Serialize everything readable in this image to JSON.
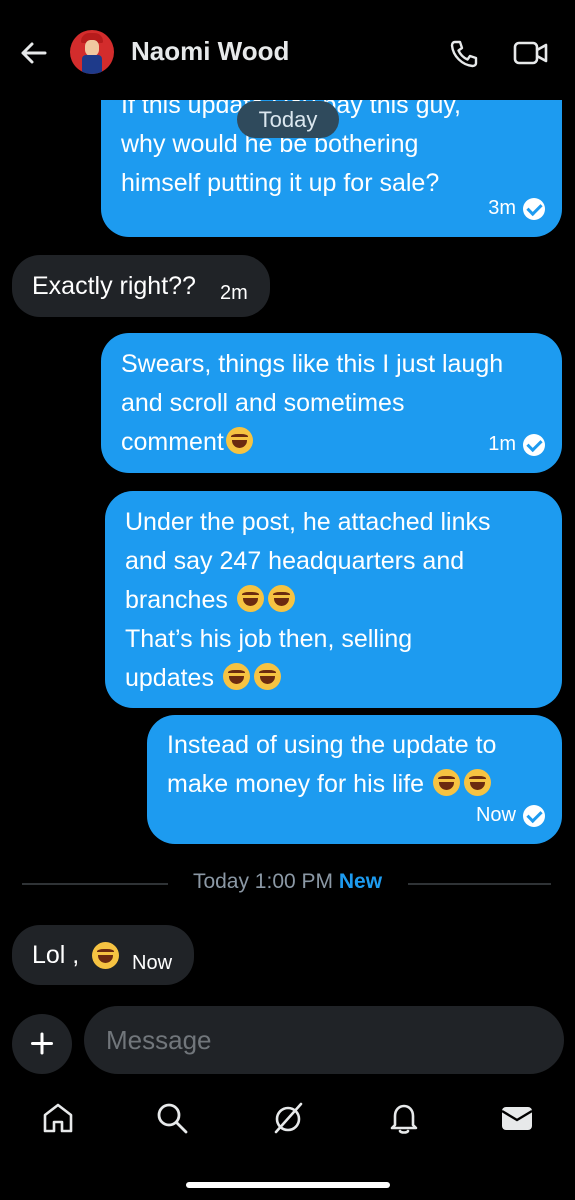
{
  "header": {
    "contact_name": "Naomi Wood",
    "back_icon": "arrow-left-icon",
    "call_icon": "phone-icon",
    "video_icon": "video-camera-icon"
  },
  "date_pill": "Today",
  "messages": [
    {
      "direction": "outgoing",
      "text": "If this update Dey pay this guy,\nwhy would he be bothering\nhimself putting it up for sale?",
      "time": "3m",
      "read": true
    },
    {
      "direction": "incoming",
      "text": "Exactly right??",
      "time": "2m"
    },
    {
      "direction": "outgoing",
      "text": "Swears, things like this I just laugh\nand scroll and sometimes\ncomment",
      "emoji_count": 1,
      "time": "1m",
      "read": true
    },
    {
      "direction": "outgoing",
      "lines": [
        "Under the post, he attached links",
        "and say 247 headquarters and",
        "branches",
        "That’s his job then, selling",
        "updates"
      ],
      "emoji": "face-with-tears-of-joy"
    },
    {
      "direction": "outgoing",
      "lines": [
        "Instead of using the update to",
        "make money for his life"
      ],
      "time": "Now",
      "read": true
    },
    {
      "direction": "incoming",
      "text": "Lol ,",
      "emoji": "grinning-squinting-face",
      "time": "Now"
    }
  ],
  "divider": {
    "label": "Today 1:00 PM",
    "new_label": "New"
  },
  "composer": {
    "placeholder": "Message",
    "plus_icon": "plus-icon"
  },
  "bottom_nav": [
    "home-icon",
    "search-icon",
    "grok-icon",
    "notifications-bell-icon",
    "messages-envelope-icon"
  ],
  "colors": {
    "background": "#000000",
    "outgoing_bubble": "#1d9bf0",
    "incoming_bubble": "#202327",
    "accent": "#1d9bf0"
  }
}
